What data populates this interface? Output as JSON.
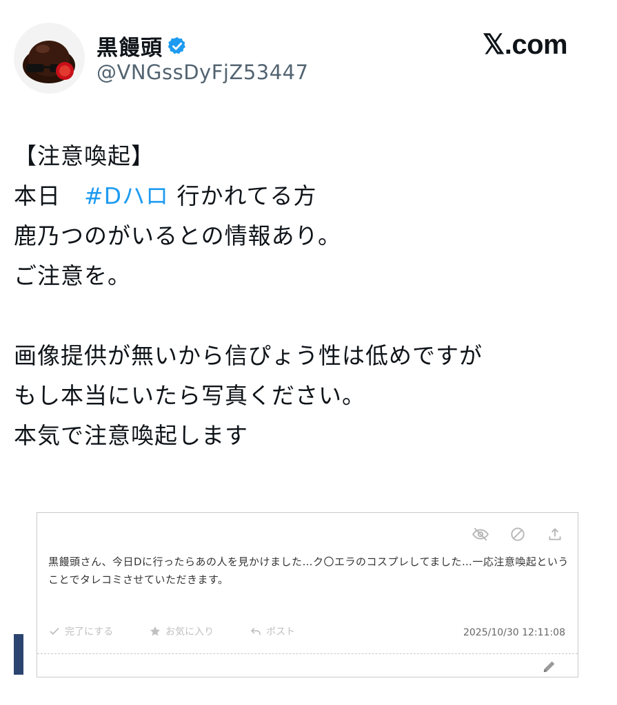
{
  "header": {
    "display_name": "黒饅頭",
    "handle": "@VNGssDyFjZ53447",
    "brand": "𝕏.com",
    "verified_color": "#1d9bf0"
  },
  "tweet": {
    "line1": "【注意喚起】",
    "line2_pre": "本日　",
    "hashtag": "#Dハロ",
    "line2_post": " 行かれてる方",
    "line3": "鹿乃つのがいるとの情報あり。",
    "line4": "ご注意を。",
    "line5": "画像提供が無いから信ぴょう性は低めですが",
    "line6": "もし本当にいたら写真ください。",
    "line7": "本気で注意喚起します",
    "hashtag_color": "#1d9bf0"
  },
  "card": {
    "message": "黒饅頭さん、今日Dに行ったらあの人を見かけました…ク〇エラのコスプレしてました…一応注意喚起ということでタレコミさせていただきます。",
    "actions": [
      "完了にする",
      "お気に入り",
      "ポスト"
    ],
    "timestamp": "2025/10/30 12:11:08",
    "icons": [
      "eye-slash-icon",
      "block-icon",
      "share-icon",
      "pencil-icon"
    ]
  }
}
